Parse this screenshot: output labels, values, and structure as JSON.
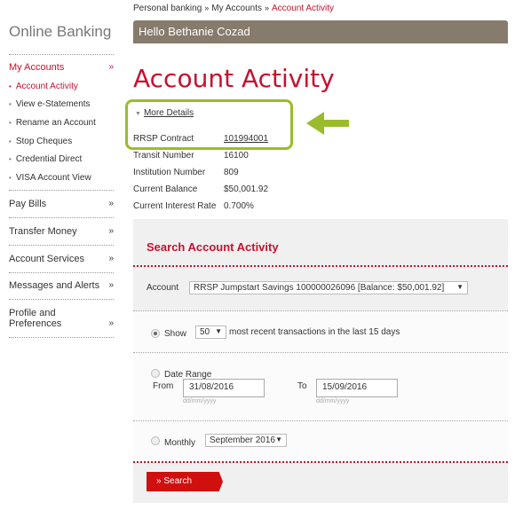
{
  "breadcrumb": [
    "Personal banking",
    "My Accounts",
    "Account Activity"
  ],
  "sidebar": {
    "title": "Online Banking",
    "my_accounts": "My Accounts",
    "sub_items": [
      "Account Activity",
      "View e-Statements",
      "Rename an Account",
      "Stop Cheques",
      "Credential Direct",
      "VISA Account View"
    ],
    "items": [
      "Pay Bills",
      "Transfer Money",
      "Account Services",
      "Messages and Alerts",
      "Profile and Preferences"
    ],
    "chevron": "»"
  },
  "greeting": "Hello Bethanie Cozad",
  "page_title": "Account Activity",
  "details": {
    "toggle": "More Details",
    "rows": [
      {
        "label": "RRSP Contract",
        "value": "101994001"
      },
      {
        "label": "Transit Number",
        "value": "16100"
      },
      {
        "label": "Institution Number",
        "value": "809"
      },
      {
        "label": "Current Balance",
        "value": "$50,001.92"
      },
      {
        "label": "Current Interest Rate",
        "value": "0.700%"
      }
    ]
  },
  "search": {
    "title": "Search Account Activity",
    "account_label": "Account",
    "account_value": "RRSP Jumpstart Savings 100000026096 [Balance: $50,001.92]",
    "show_label": "Show",
    "show_value": "50",
    "show_suffix": "most recent transactions in the last 15 days",
    "date_range_label": "Date Range",
    "from_label": "From",
    "from_value": "31/08/2016",
    "to_label": "To",
    "to_value": "15/09/2016",
    "date_hint": "dd/mm/yyyy",
    "monthly_label": "Monthly",
    "monthly_value": "September 2016",
    "button": "» Search",
    "selected_option": "show"
  },
  "colors": {
    "accent": "#c8102e",
    "header": "#877b6c",
    "highlight": "#9abc2c"
  }
}
